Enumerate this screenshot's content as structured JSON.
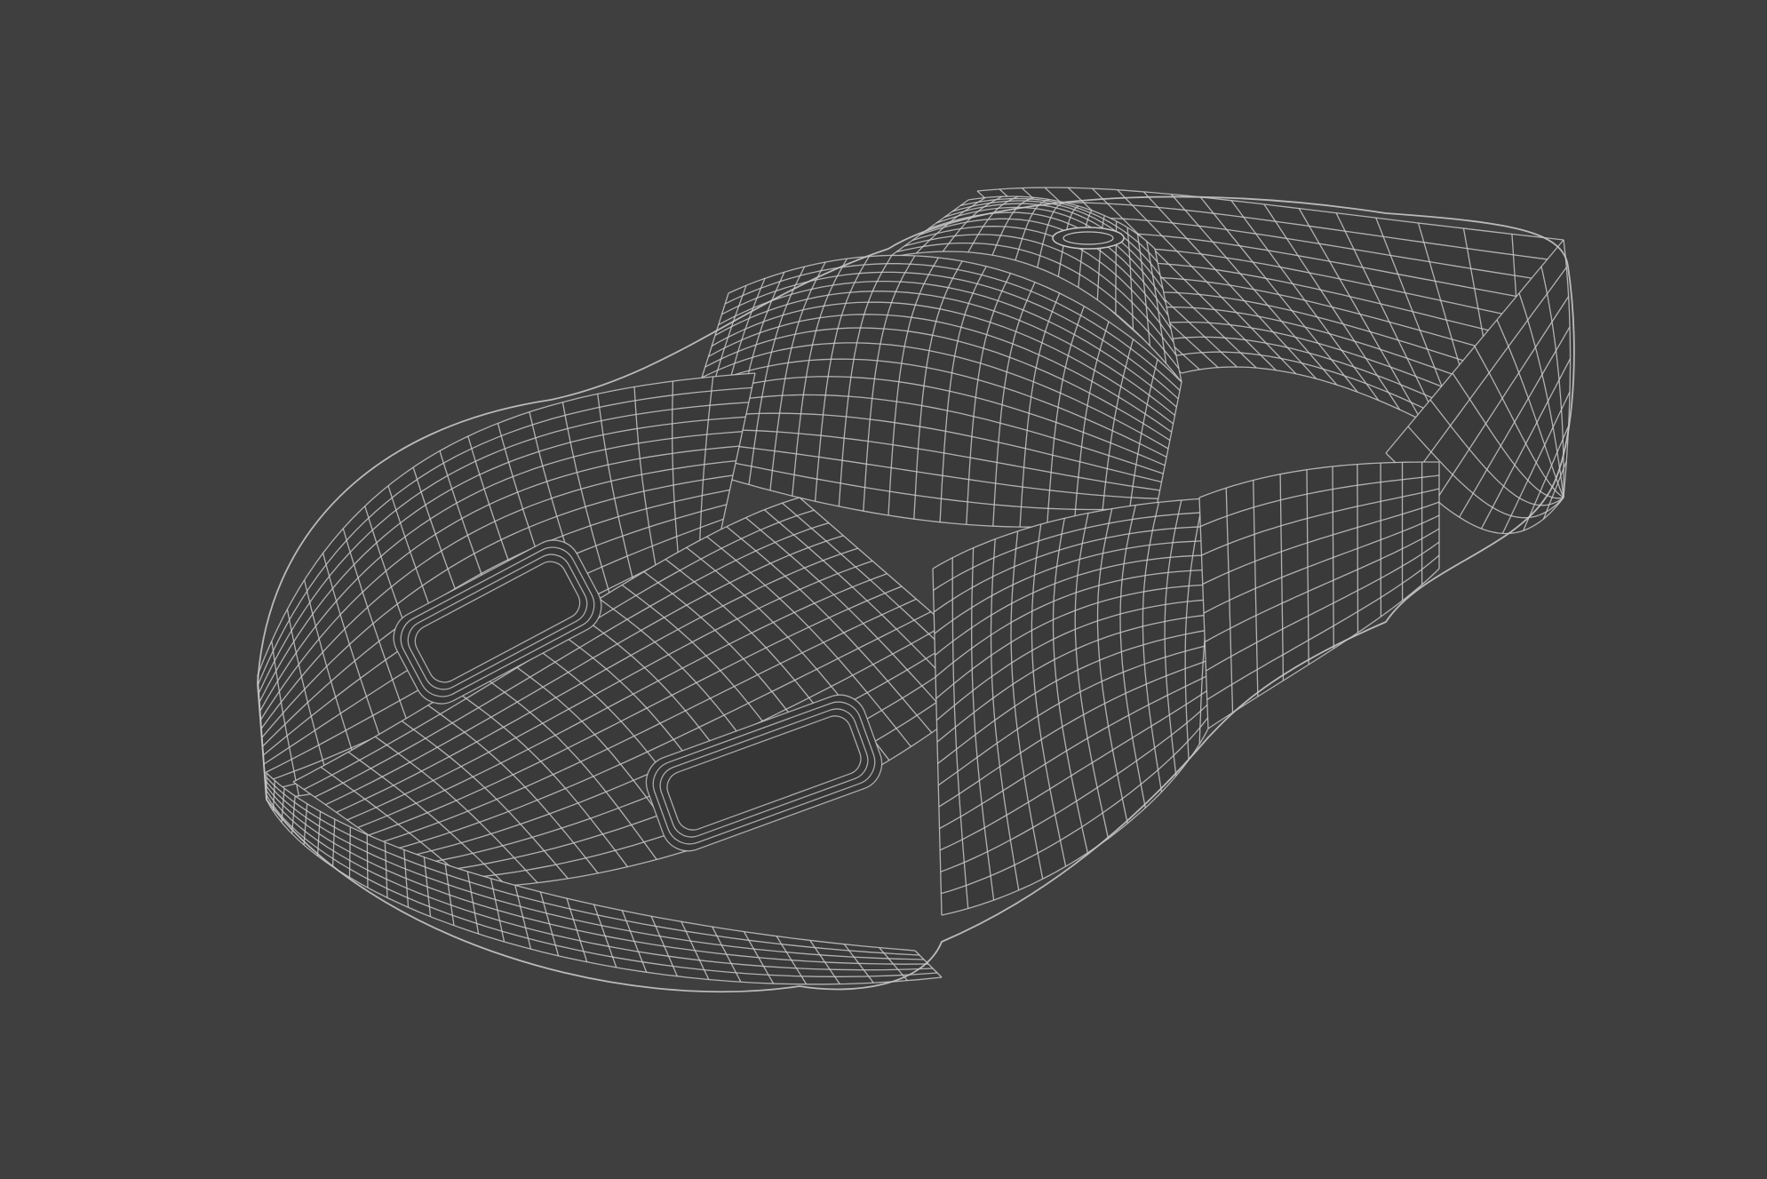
{
  "viewport": {
    "background": "#3f3f3f",
    "object": {
      "name": "race-car-body",
      "render_mode": "wireframe",
      "wire_color": "#c8c8c8",
      "surface_color": "#3a3a3a"
    }
  }
}
